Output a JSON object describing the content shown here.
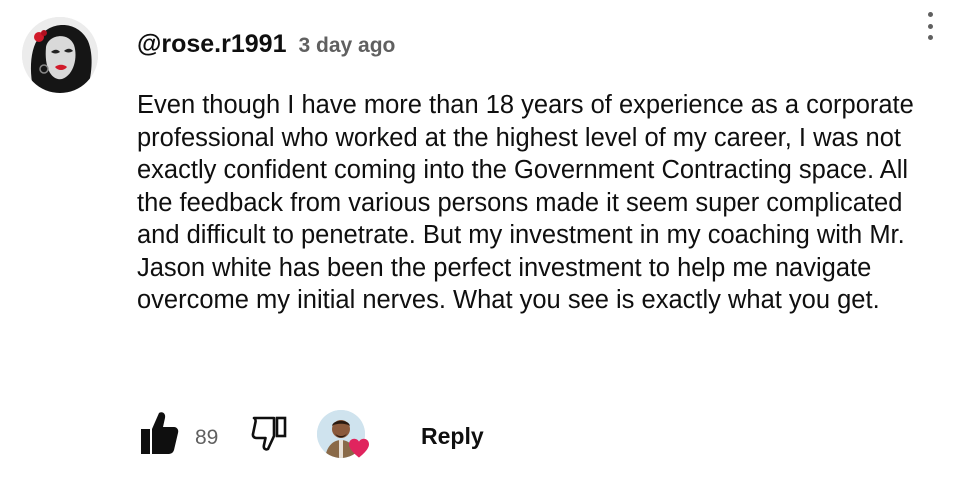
{
  "comment": {
    "handle": "@rose.r1991",
    "time_ago": "3 day ago",
    "text": "Even though I have more than 18 years of experience as a corporate professional who worked at the highest level of my career, I was not exactly confident coming into the Government Contracting space. All the feedback from various persons made it seem super complicated and difficult to penetrate. But my investment in my coaching with Mr. Jason white has been the perfect investment to help me navigate overcome my initial nerves. What you see is exactly what you get.",
    "like_count": "89",
    "reply_label": "Reply"
  },
  "icons": {
    "menu": "more-vert-icon",
    "like": "thumbs-up-filled-icon",
    "dislike": "thumbs-down-outline-icon",
    "creator_heart": "heart-icon"
  },
  "colors": {
    "text_primary": "#0f0f0f",
    "text_secondary": "#606060",
    "heart": "#e0245e"
  }
}
